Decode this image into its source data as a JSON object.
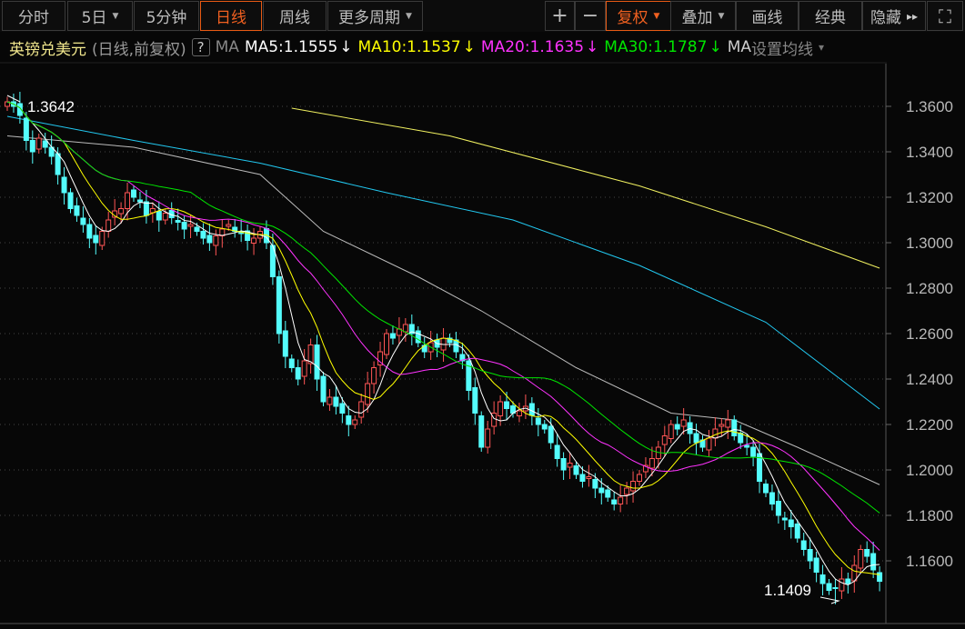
{
  "toolbar": {
    "left": [
      {
        "label": "分时",
        "caret": false
      },
      {
        "label": "5日",
        "caret": true
      },
      {
        "label": "5分钟",
        "caret": false
      },
      {
        "label": "日线",
        "caret": false,
        "active": true
      },
      {
        "label": "周线",
        "caret": false
      },
      {
        "label": "更多周期",
        "caret": true
      }
    ],
    "zoom_in": "+",
    "zoom_out": "−",
    "right": [
      {
        "label": "复权",
        "caret": true,
        "active": true
      },
      {
        "label": "叠加",
        "caret": true
      },
      {
        "label": "画线"
      },
      {
        "label": "经典"
      },
      {
        "label": "隐藏",
        "arrows": "▸▸"
      }
    ],
    "fullscreen_icon": "⛶"
  },
  "legend": {
    "title": "英镑兑美元",
    "mode": "(日线,前复权)",
    "help": "?",
    "ma_label": "MA",
    "ma5": "MA5:1.1555",
    "ma10": "MA10:1.1537",
    "ma20": "MA20:1.1635",
    "ma30": "MA30:1.1787",
    "arrow": "↓",
    "settings_ma": "MA",
    "settings": "设置均线",
    "settings_caret": "▾"
  },
  "colors": {
    "up": "#ff5555",
    "down": "#54fcfc",
    "ma5": "#ffffff",
    "ma10": "#ffff00",
    "ma20": "#ff33ff",
    "ma30": "#00e600",
    "ma60": "#bbbbbb",
    "ma120": "#22c8f0",
    "ma250": "#f0f060",
    "accent": "#f06020"
  },
  "chart_data": {
    "type": "candlestick",
    "title": "英镑兑美元 日线",
    "ylim": [
      1.136,
      1.362
    ],
    "yticks": [
      "1.3600",
      "1.3400",
      "1.3200",
      "1.3000",
      "1.2800",
      "1.2600",
      "1.2400",
      "1.2200",
      "1.2000",
      "1.1800",
      "1.1600"
    ],
    "ytick_values": [
      1.36,
      1.34,
      1.32,
      1.3,
      1.28,
      1.26,
      1.24,
      1.22,
      1.2,
      1.18,
      1.16
    ],
    "max_label": "1.3642",
    "min_label": "1.1409",
    "max_value": 1.3642,
    "min_value": 1.1409,
    "max_index": 0,
    "min_index": 131,
    "close": [
      1.362,
      1.36,
      1.356,
      1.345,
      1.34,
      1.346,
      1.342,
      1.338,
      1.33,
      1.322,
      1.315,
      1.312,
      1.308,
      1.302,
      1.3,
      1.305,
      1.31,
      1.314,
      1.315,
      1.322,
      1.32,
      1.318,
      1.312,
      1.315,
      1.31,
      1.313,
      1.311,
      1.309,
      1.306,
      1.308,
      1.305,
      1.302,
      1.3,
      1.303,
      1.306,
      1.308,
      1.305,
      1.304,
      1.301,
      1.302,
      1.305,
      1.3,
      1.285,
      1.26,
      1.25,
      1.245,
      1.24,
      1.248,
      1.255,
      1.24,
      1.23,
      1.232,
      1.228,
      1.225,
      1.22,
      1.222,
      1.23,
      1.238,
      1.245,
      1.252,
      1.26,
      1.258,
      1.262,
      1.264,
      1.26,
      1.256,
      1.252,
      1.256,
      1.254,
      1.258,
      1.256,
      1.252,
      1.248,
      1.235,
      1.225,
      1.21,
      1.218,
      1.225,
      1.23,
      1.227,
      1.225,
      1.226,
      1.228,
      1.224,
      1.22,
      1.218,
      1.212,
      1.205,
      1.2,
      1.203,
      1.198,
      1.195,
      1.197,
      1.192,
      1.19,
      1.188,
      1.185,
      1.188,
      1.192,
      1.195,
      1.198,
      1.202,
      1.205,
      1.21,
      1.215,
      1.22,
      1.218,
      1.222,
      1.216,
      1.212,
      1.21,
      1.214,
      1.218,
      1.22,
      1.222,
      1.215,
      1.212,
      1.21,
      1.206,
      1.195,
      1.19,
      1.185,
      1.18,
      1.178,
      1.175,
      1.17,
      1.165,
      1.16,
      1.155,
      1.15,
      1.147,
      1.148,
      1.152,
      1.15,
      1.158,
      1.165,
      1.162,
      1.156,
      1.151
    ],
    "ma_periods": [
      5,
      10,
      20,
      30
    ],
    "long_ma": [
      {
        "name": "MA60",
        "color_key": "ma60",
        "points": [
          [
            0,
            1.347
          ],
          [
            20,
            1.342
          ],
          [
            40,
            1.33
          ],
          [
            50,
            1.305
          ],
          [
            65,
            1.285
          ],
          [
            75,
            1.27
          ],
          [
            90,
            1.245
          ],
          [
            105,
            1.225
          ],
          [
            115,
            1.222
          ],
          [
            125,
            1.21
          ],
          [
            138,
            1.1935
          ]
        ]
      },
      {
        "name": "MA120",
        "color_key": "ma120",
        "points": [
          [
            0,
            1.3556
          ],
          [
            20,
            1.345
          ],
          [
            40,
            1.335
          ],
          [
            60,
            1.322
          ],
          [
            80,
            1.31
          ],
          [
            100,
            1.29
          ],
          [
            120,
            1.265
          ],
          [
            138,
            1.2268
          ]
        ]
      },
      {
        "name": "MA250",
        "color_key": "ma250",
        "points": [
          [
            45,
            1.3592
          ],
          [
            70,
            1.347
          ],
          [
            100,
            1.325
          ],
          [
            120,
            1.307
          ],
          [
            138,
            1.2888
          ]
        ]
      }
    ]
  }
}
